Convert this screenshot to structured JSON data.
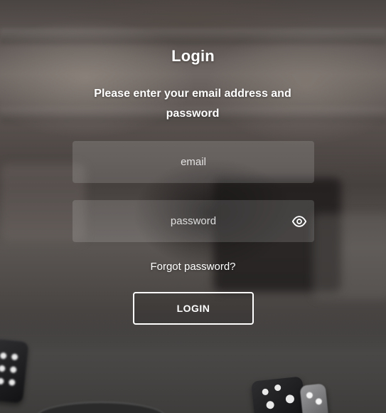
{
  "login": {
    "title": "Login",
    "subtitle": "Please enter your email address and password",
    "email_placeholder": "email",
    "email_value": "",
    "password_placeholder": "password",
    "password_value": "",
    "password_toggle_icon": "eye-icon",
    "forgot_password_label": "Forgot password?",
    "submit_label": "LOGIN"
  },
  "theme": {
    "text_color": "#ffffff",
    "field_background": "rgba(255,255,255,0.14)"
  }
}
